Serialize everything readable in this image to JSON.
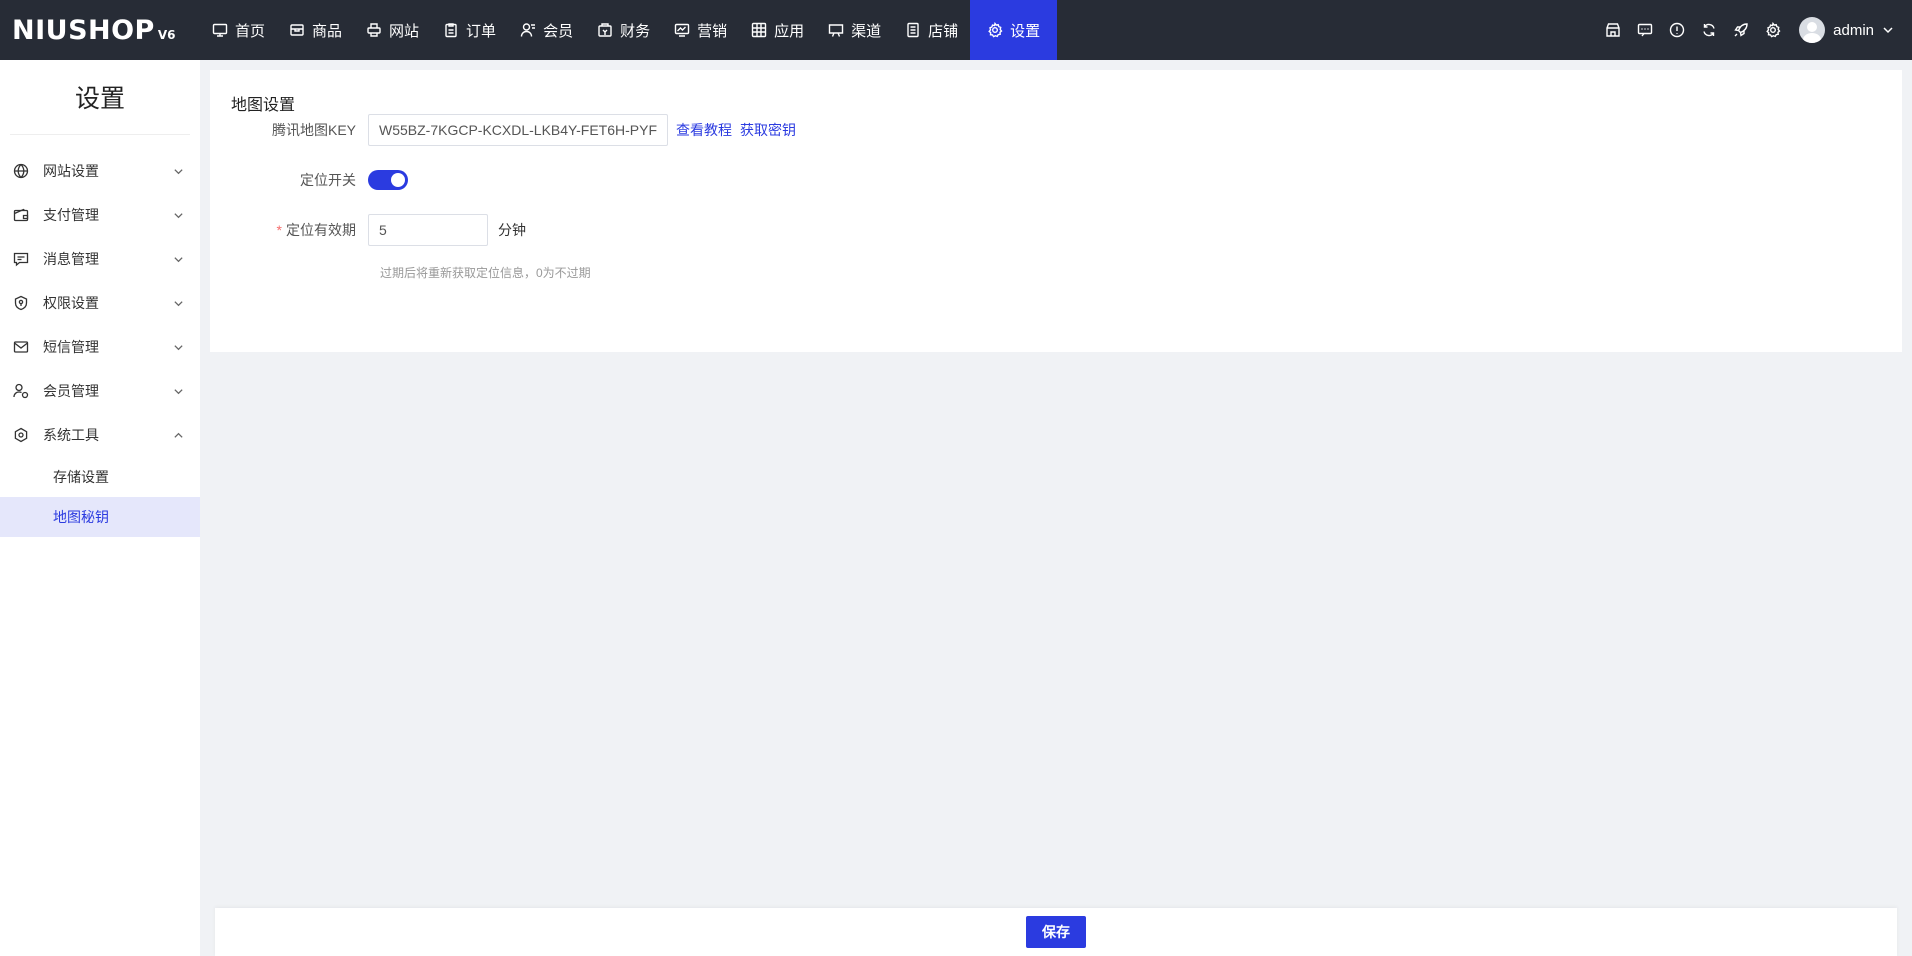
{
  "logo": {
    "main": "NIUSHOP",
    "version": "V6"
  },
  "nav": [
    {
      "label": "首页",
      "icon": "monitor-icon"
    },
    {
      "label": "商品",
      "icon": "box-icon"
    },
    {
      "label": "网站",
      "icon": "printer-icon"
    },
    {
      "label": "订单",
      "icon": "clipboard-icon"
    },
    {
      "label": "会员",
      "icon": "user-icon"
    },
    {
      "label": "财务",
      "icon": "wallet-icon"
    },
    {
      "label": "营销",
      "icon": "chart-icon"
    },
    {
      "label": "应用",
      "icon": "grid-icon"
    },
    {
      "label": "渠道",
      "icon": "screen-icon"
    },
    {
      "label": "店铺",
      "icon": "doc-icon"
    },
    {
      "label": "设置",
      "icon": "gear-icon",
      "active": true
    }
  ],
  "header_tools": [
    "store-icon",
    "message-icon",
    "info-icon",
    "refresh-icon",
    "rocket-icon",
    "settings-icon"
  ],
  "user": {
    "name": "admin"
  },
  "sidebar": {
    "title": "设置",
    "items": [
      {
        "label": "网站设置",
        "icon": "globe-icon",
        "expanded": false
      },
      {
        "label": "支付管理",
        "icon": "wallet-icon",
        "expanded": false
      },
      {
        "label": "消息管理",
        "icon": "chat-icon",
        "expanded": false
      },
      {
        "label": "权限设置",
        "icon": "shield-icon",
        "expanded": false
      },
      {
        "label": "短信管理",
        "icon": "mail-icon",
        "expanded": false
      },
      {
        "label": "会员管理",
        "icon": "user-settings-icon",
        "expanded": false
      },
      {
        "label": "系统工具",
        "icon": "hexagon-gear-icon",
        "expanded": true
      }
    ],
    "sub_items": [
      {
        "label": "存储设置",
        "active": false
      },
      {
        "label": "地图秘钥",
        "active": true
      }
    ]
  },
  "form": {
    "section_title": "地图设置",
    "map_key_label": "腾讯地图KEY",
    "map_key_value": "W55BZ-7KGCP-KCXDL-LKB4Y-FET6H-PYF",
    "tutorial_link": "查看教程",
    "get_key_link": "获取密钥",
    "location_switch_label": "定位开关",
    "location_switch_on": true,
    "validity_required_mark": "*",
    "validity_label": "定位有效期",
    "validity_value": "5",
    "validity_unit": "分钟",
    "validity_hint": "过期后将重新获取定位信息，0为不过期"
  },
  "footer": {
    "save_label": "保存"
  },
  "colors": {
    "primary": "#2b3be0",
    "topbar": "#272c36",
    "background": "#f0f2f5"
  }
}
